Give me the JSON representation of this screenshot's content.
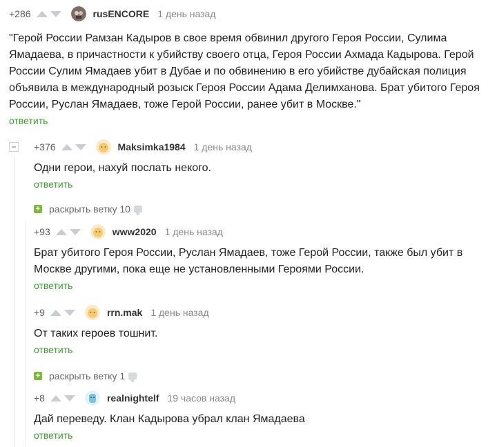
{
  "comments": [
    {
      "rating": "+286",
      "author": "rusENCORE",
      "time": "1 день назад",
      "text": "\"Герой России Рамзан Кадыров в свое время обвинил другого Героя России, Сулима Ямадаева, в причастности к убийству своего отца, Героя России Ахмада Кадырова. Герой России Сулим Ямадаев убит в Дубае и по обвинению в его убийстве дубайская полиция объявила в международный розыск Героя России Адама Делимханова. Брат убитого Героя России, Руслан Ямадаев, тоже Герой России, ранее убит в Москве.\"",
      "reply": "ответить"
    },
    {
      "rating": "+376",
      "author": "Maksimka1984",
      "time": "1 день назад",
      "text": "Одни герои, нахуй послать некого.",
      "reply": "ответить"
    },
    {
      "rating": "+93",
      "author": "www2020",
      "time": "1 день назад",
      "text": "Брат убитого Героя России, Руслан Ямадаев, тоже Герой России, также был убит в Москве другими, пока еще не установленными Героями России.",
      "reply": "ответить"
    },
    {
      "rating": "+9",
      "author": "rrn.mak",
      "time": "1 день назад",
      "text": "От таких героев тошнит.",
      "reply": "ответить"
    },
    {
      "rating": "+8",
      "author": "realnightelf",
      "time": "19 часов назад",
      "text": "Дай переведу. Клан Кадырова убрал клан Ямадаева",
      "reply": "ответить"
    }
  ],
  "expanders": [
    {
      "label": "раскрыть ветку 10"
    },
    {
      "label": "раскрыть ветку 1"
    }
  ],
  "colors": {
    "reply_link": "#3f9a32",
    "expand_plus": "#7cba3c",
    "vote_arrow": "#c9ccd0"
  }
}
